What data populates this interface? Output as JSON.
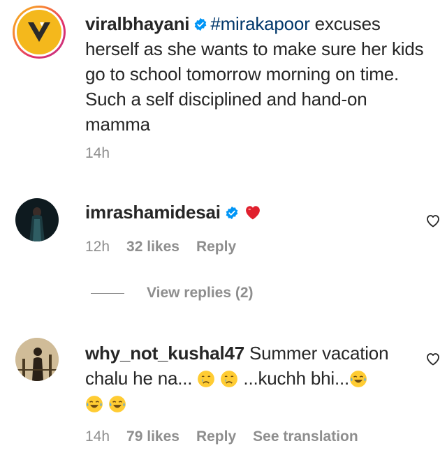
{
  "caption": {
    "username": "viralbhayani",
    "hashtag": "#mirakapoor",
    "text": " excuses herself as she wants to make sure her kids go to school tomorrow morning on time. Such a self disciplined and hand-on mamma",
    "time": "14h"
  },
  "comments": [
    {
      "username": "imrashamidesai",
      "time": "12h",
      "likes": "32 likes",
      "reply": "Reply",
      "emoji": [
        "red-heart"
      ]
    },
    {
      "username": "why_not_kushal47",
      "text_a": " Summer vacation chalu he na...",
      "text_b": " ...kuchh bhi...",
      "time": "14h",
      "likes": "79 likes",
      "reply": "Reply",
      "see_translation": "See translation",
      "emoji": [
        "crying-face",
        "crying-face",
        "tears-of-joy",
        "tears-of-joy",
        "tears-of-joy"
      ]
    }
  ],
  "view_replies": "View replies (2)",
  "colors": {
    "text": "#262626",
    "muted": "#8e8e8e",
    "hashtag": "#00376b",
    "verified": "#0095f6",
    "heart": "#ed4956",
    "logo_yellow": "#f4b81c"
  }
}
